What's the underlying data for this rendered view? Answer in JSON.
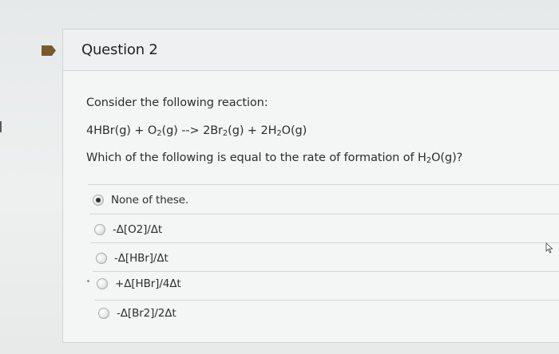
{
  "question": {
    "title": "Question 2",
    "prompt": "Consider the following reaction:",
    "reaction": {
      "left_1": "4HBr(g) + O",
      "left_1_sub": "2",
      "left_2": "(g) --> 2Br",
      "right_1_sub": "2",
      "right_2": "(g) + 2H",
      "right_2_sub": "2",
      "right_3": "O(g)"
    },
    "ask": {
      "before": "Which of the following is equal to the rate of formation of H",
      "sub": "2",
      "after": "O(g)?"
    }
  },
  "answers": [
    {
      "label": "None of these.",
      "selected": true
    },
    {
      "label": "-Δ[O2]/Δt",
      "selected": false
    },
    {
      "label": "-Δ[HBr]/Δt",
      "selected": false
    },
    {
      "label": "+Δ[HBr]/4Δt",
      "selected": false
    },
    {
      "label": "-Δ[Br2]/2Δt",
      "selected": false
    }
  ],
  "colors": {
    "flag": "#7a5a2c",
    "selected_dot": "#2f3233"
  },
  "icons": {
    "flag": "bookmark-flag-icon",
    "cursor": "mouse-cursor-icon"
  }
}
